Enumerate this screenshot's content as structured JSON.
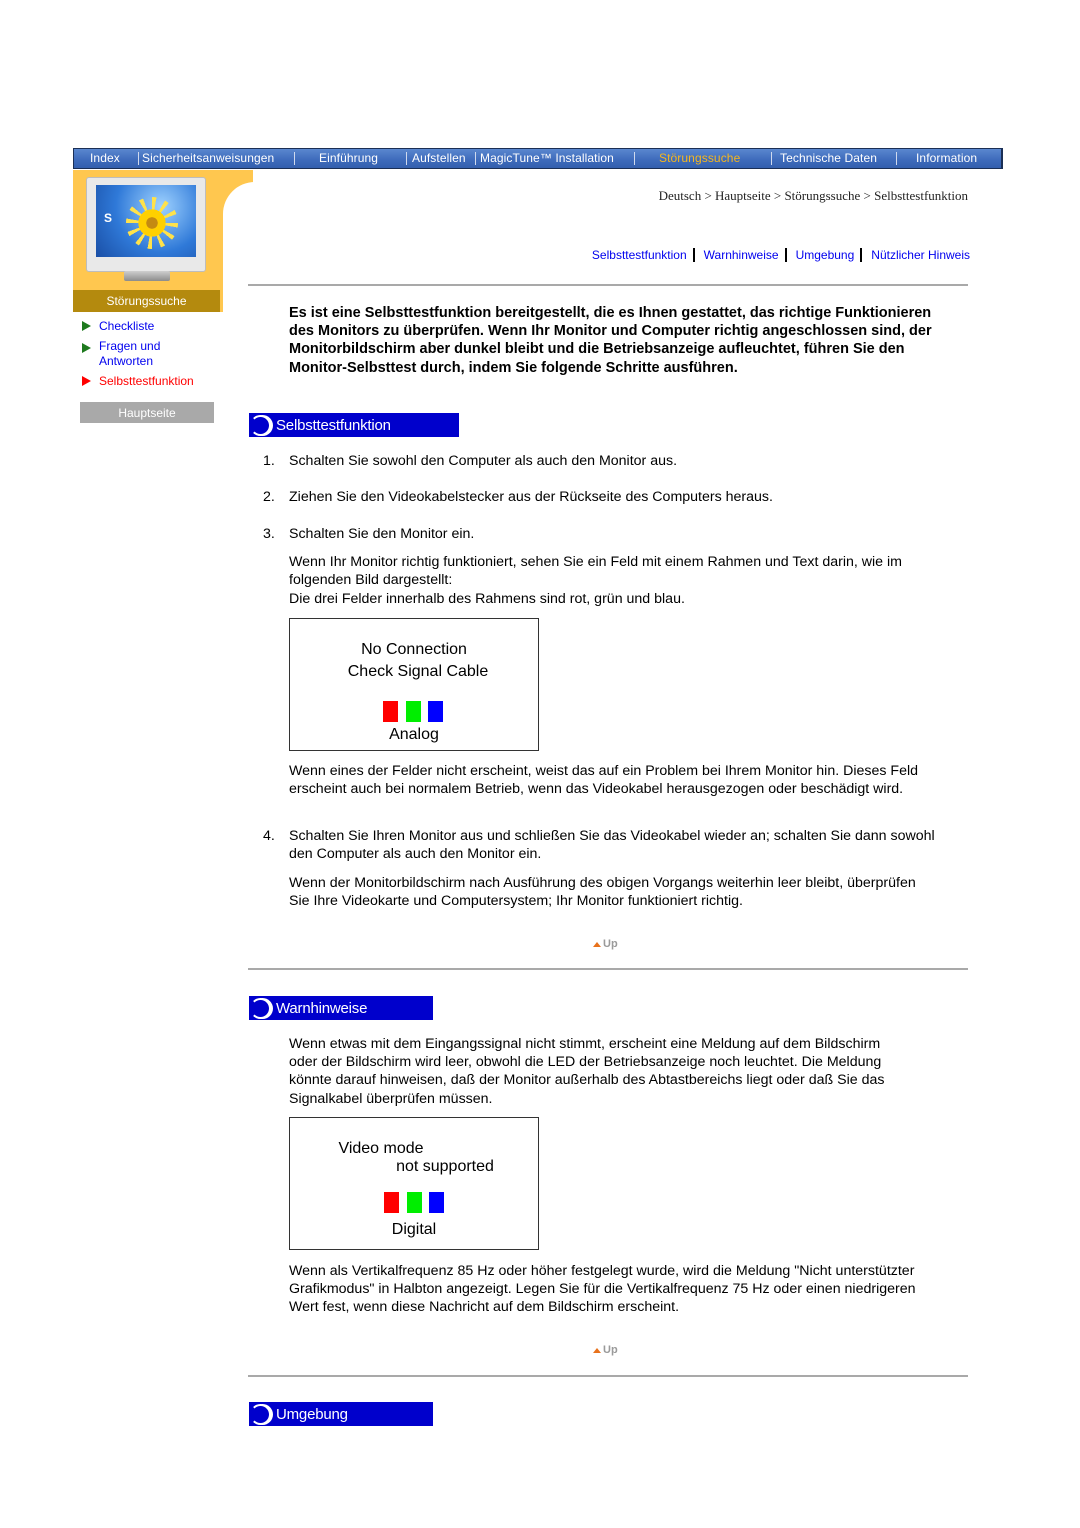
{
  "topnav": {
    "items": [
      {
        "label": "Index",
        "active": false
      },
      {
        "label": "Sicherheitsanweisungen",
        "active": false
      },
      {
        "label": "Einführung",
        "active": false
      },
      {
        "label": "Aufstellen",
        "active": false
      },
      {
        "label": "MagicTune™ Installation",
        "active": false
      },
      {
        "label": "Störungssuche",
        "active": true
      },
      {
        "label": "Technische Daten",
        "active": false
      },
      {
        "label": "Information",
        "active": false
      }
    ]
  },
  "sidebar": {
    "monitor_logo": "S",
    "section_title": "Störungssuche",
    "links": [
      {
        "label": "Checkliste",
        "active": false
      },
      {
        "label": "Fragen und Antworten",
        "active": false
      },
      {
        "label": "Selbsttestfunktion",
        "active": true
      }
    ],
    "home_button": "Hauptseite"
  },
  "breadcrumb": "Deutsch > Hauptseite > Störungssuche > Selbsttestfunktion",
  "anchor_links": [
    "Selbsttestfunktion",
    "Warnhinweise",
    "Umgebung",
    "Nützlicher Hinweis"
  ],
  "intro": "Es ist eine Selbsttestfunktion bereitgestellt, die es Ihnen gestattet, das richtige Funktionieren des Monitors zu überprüfen. Wenn Ihr Monitor und Computer richtig angeschlossen sind, der Monitorbildschirm aber dunkel bleibt und die Betriebsanzeige aufleuchtet, führen Sie den Monitor-Selbsttest durch, indem Sie folgende Schritte ausführen.",
  "sections": {
    "selftest": {
      "heading": "Selbsttestfunktion",
      "steps": [
        {
          "num": "1.",
          "text": "Schalten Sie sowohl den Computer als auch den Monitor aus."
        },
        {
          "num": "2.",
          "text": "Ziehen Sie den Videokabelstecker aus der Rückseite des Computers heraus."
        },
        {
          "num": "3.",
          "text": "Schalten Sie den Monitor ein."
        },
        {
          "num": "4.",
          "text": "Schalten Sie Ihren Monitor aus und schließen Sie das Videokabel wieder an; schalten Sie dann sowohl den Computer als auch den Monitor ein."
        }
      ],
      "step3_note": "Wenn Ihr Monitor richtig funktioniert, sehen Sie ein Feld mit einem Rahmen und Text darin, wie im folgenden Bild dargestellt:",
      "step3_note2": "Die drei Felder innerhalb des Rahmens sind rot, grün und blau.",
      "osd": {
        "line1": "No Connection",
        "line2": "Check Signal Cable",
        "mode": "Analog"
      },
      "after_osd": "Wenn eines der Felder nicht erscheint, weist das auf ein Problem bei Ihrem Monitor hin. Dieses Feld erscheint auch bei normalem Betrieb, wenn das Videokabel herausgezogen oder beschädigt wird.",
      "after_step4": "Wenn der Monitorbildschirm nach Ausführung des obigen Vorgangs weiterhin leer bleibt, überprüfen Sie Ihre Videokarte und Computersystem; Ihr Monitor funktioniert richtig.",
      "up_label": "Up"
    },
    "warnings": {
      "heading": "Warnhinweise",
      "text1": "Wenn etwas mit dem Eingangssignal nicht stimmt, erscheint eine Meldung auf dem Bildschirm oder der Bildschirm wird leer, obwohl die LED der Betriebsanzeige noch leuchtet. Die Meldung könnte darauf hinweisen, daß der Monitor außerhalb des Abtastbereichs liegt oder daß Sie das Signalkabel überprüfen müssen.",
      "osd": {
        "line1": "Video mode",
        "line2": "not supported",
        "mode": "Digital"
      },
      "text2": "Wenn als Vertikalfrequenz 85 Hz oder höher festgelegt wurde, wird die Meldung \"Nicht unterstützter Grafikmodus\" in Halbton angezeigt. Legen Sie für die Vertikalfrequenz 75 Hz oder einen niedrigeren Wert fest, wenn diese Nachricht auf dem Bildschirm erscheint.",
      "up_label": "Up"
    },
    "environment": {
      "heading": "Umgebung"
    }
  },
  "colors": {
    "nav_bg": "#3f6cbc",
    "nav_active": "#f5b61e",
    "sidebar_bg": "#ffc74f",
    "section_banner": "#b48a0e",
    "heading_bar": "#0000cc",
    "link": "#0000ee",
    "link_active": "#ff0000"
  }
}
